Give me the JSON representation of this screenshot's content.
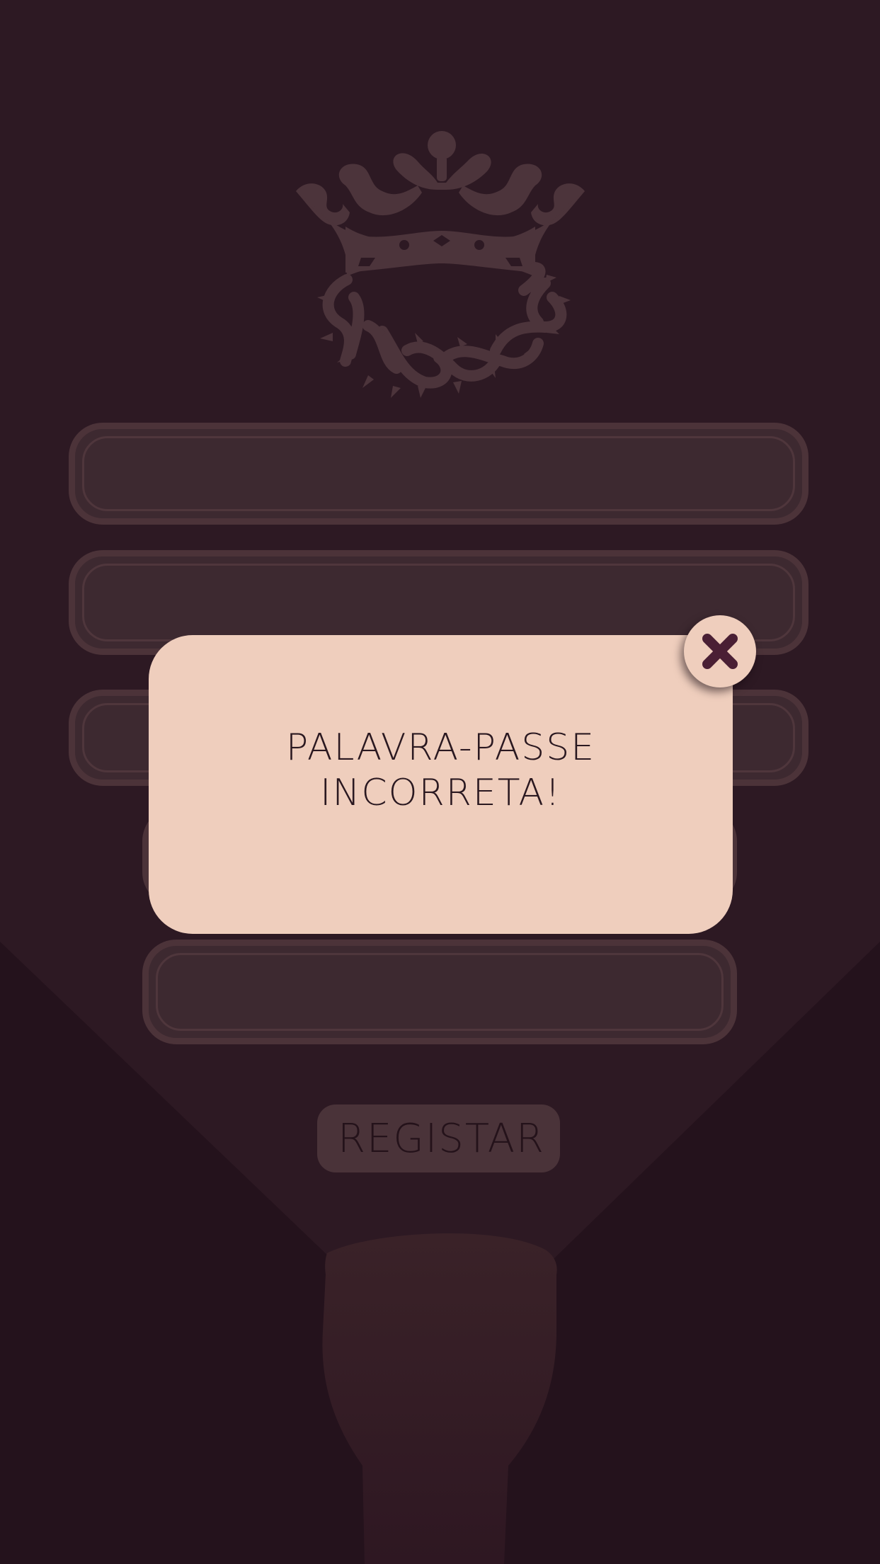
{
  "form": {
    "fields": [
      {
        "value": "",
        "placeholder": ""
      },
      {
        "value": "",
        "placeholder": ""
      },
      {
        "value": "",
        "placeholder": ""
      },
      {
        "value": "",
        "placeholder": ""
      },
      {
        "value": "",
        "placeholder": ""
      }
    ],
    "register_label": "REGISTAR"
  },
  "dialog": {
    "message": "PALAVRA-PASSE INCORRETA!",
    "close_icon": "close-icon"
  },
  "icons": {
    "logo": "crown-with-crown-of-thorns-logo"
  },
  "colors": {
    "background": "#2d1923",
    "field": "#3d2930",
    "field_border": "#4c3339",
    "dialog": "#efcebd",
    "close_glyph": "#4a1f34",
    "text_dark": "#2a1820"
  }
}
